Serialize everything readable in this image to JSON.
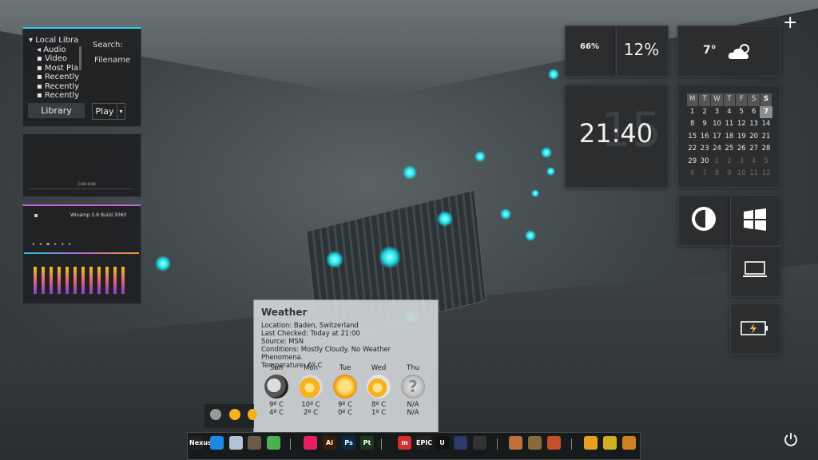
{
  "media_player": {
    "tree": [
      "Local Libra",
      "Audio",
      "Video",
      "Most Pla",
      "Recently",
      "Recently",
      "Recently"
    ],
    "search_label": "Search:",
    "filename_label": "Filename",
    "library_button": "Library",
    "play_button": "Play",
    "time_display": "0:00:0:00",
    "winamp_title": "Winamp 5.6 Build 3060"
  },
  "system_meters": {
    "cpu": "66%",
    "ram": "12%"
  },
  "weather_tile": {
    "temp": "7°",
    "icon": "cloud-sun-icon"
  },
  "clock": {
    "time": "21:40",
    "ghost_date": "15"
  },
  "calendar": {
    "headers": [
      "M",
      "T",
      "W",
      "T",
      "F",
      "S",
      "S"
    ],
    "rows": [
      [
        "1",
        "2",
        "3",
        "4",
        "5",
        "6",
        "7"
      ],
      [
        "8",
        "9",
        "10",
        "11",
        "12",
        "13",
        "14"
      ],
      [
        "15",
        "16",
        "17",
        "18",
        "19",
        "20",
        "21"
      ],
      [
        "22",
        "23",
        "24",
        "25",
        "26",
        "27",
        "28"
      ],
      [
        "29",
        "30",
        "1",
        "2",
        "3",
        "4",
        "5"
      ],
      [
        "6",
        "7",
        "8",
        "9",
        "10",
        "11",
        "12"
      ]
    ],
    "today": "7"
  },
  "quick_tiles": [
    "rainmeter-icon",
    "windows-logo-icon",
    "laptop-icon",
    "battery-icon"
  ],
  "weather_popup": {
    "title": "Weather",
    "location": "Location: Baden, Switzerland",
    "last_checked": "Last Checked: Today at 21:00",
    "source": "Source: MSN",
    "conditions": "Conditions: Mostly Cloudy. No Weather Phenomena.",
    "temperature": "Temperature: 6º C",
    "forecast": [
      {
        "day": "Sun",
        "high": "9º C",
        "low": "4º C",
        "icon": "night-cloud-icon"
      },
      {
        "day": "Mon",
        "high": "10º C",
        "low": "2º C",
        "icon": "sun-cloud-icon"
      },
      {
        "day": "Tue",
        "high": "9º C",
        "low": "0º C",
        "icon": "sun-icon"
      },
      {
        "day": "Wed",
        "high": "8º C",
        "low": "1º C",
        "icon": "sun-cloud-icon"
      },
      {
        "day": "Thu",
        "high": "N/A",
        "low": "N/A",
        "icon": "unknown-icon"
      }
    ]
  },
  "dock": {
    "items": [
      {
        "label": "Nexus",
        "color": "#222"
      },
      {
        "label": "",
        "color": "#1e88e5"
      },
      {
        "label": "",
        "color": "#b0c4d8"
      },
      {
        "label": "",
        "color": "#6b5a45"
      },
      {
        "label": "",
        "color": "#4caf50"
      },
      {
        "label": "",
        "color": "#e91e63"
      },
      {
        "label": "Ai",
        "color": "#3b1d05"
      },
      {
        "label": "Ps",
        "color": "#0a2a4a"
      },
      {
        "label": "Pt",
        "color": "#1b3a1b"
      },
      {
        "label": "m",
        "color": "#d32f2f"
      },
      {
        "label": "EPIC",
        "color": "#222"
      },
      {
        "label": "U",
        "color": "#111"
      },
      {
        "label": "",
        "color": "#2a3a6a"
      },
      {
        "label": "",
        "color": "#333"
      },
      {
        "label": "",
        "color": "#c0703a"
      },
      {
        "label": "",
        "color": "#8a6a3a"
      },
      {
        "label": "",
        "color": "#c2502a"
      },
      {
        "label": "",
        "color": "#e8a020"
      },
      {
        "label": "",
        "color": "#d0b020"
      },
      {
        "label": "",
        "color": "#d08020"
      }
    ]
  },
  "power_icon": "power-icon",
  "plus_icon": "plus-icon"
}
